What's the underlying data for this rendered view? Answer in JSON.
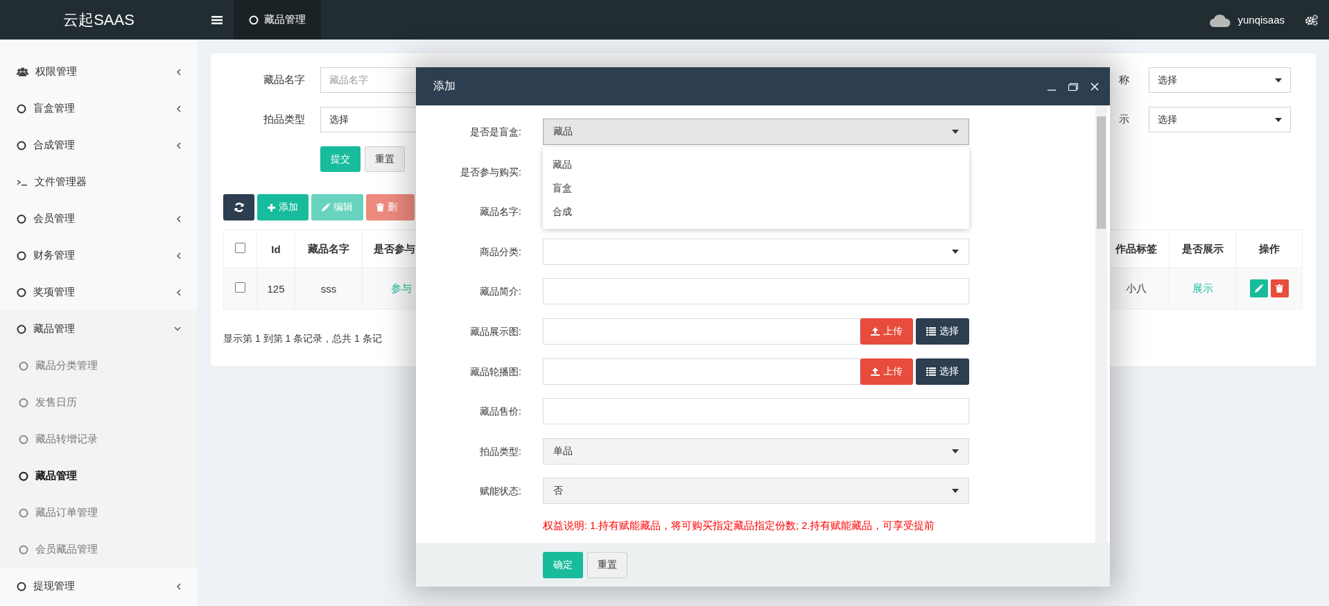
{
  "topbar": {
    "logo": "云起SAAS",
    "tab": {
      "label": "藏品管理",
      "selected": true
    },
    "user": "yunqisaas"
  },
  "sidebar": {
    "items": [
      {
        "label": "权限管理",
        "kind": "users",
        "expanded": false
      },
      {
        "label": "盲盒管理",
        "kind": "circle",
        "expanded": false
      },
      {
        "label": "合成管理",
        "kind": "circle",
        "expanded": false
      },
      {
        "label": "文件管理器",
        "kind": "terminal"
      },
      {
        "label": "会员管理",
        "kind": "circle",
        "expanded": false
      },
      {
        "label": "财务管理",
        "kind": "circle",
        "expanded": false
      },
      {
        "label": "奖项管理",
        "kind": "circle",
        "expanded": false
      },
      {
        "label": "藏品管理",
        "kind": "circle",
        "expanded": true,
        "children": [
          {
            "label": "藏品分类管理",
            "selected": false
          },
          {
            "label": "发售日历",
            "selected": false
          },
          {
            "label": "藏品转增记录",
            "selected": false
          },
          {
            "label": "藏品管理",
            "selected": true
          },
          {
            "label": "藏品订单管理",
            "selected": false
          },
          {
            "label": "会员藏品管理",
            "selected": false
          }
        ]
      },
      {
        "label": "提现管理",
        "kind": "circle",
        "expanded": false
      }
    ]
  },
  "filters": {
    "left": [
      {
        "label": "藏品名字",
        "kind": "input",
        "placeholder": "藏品名字"
      },
      {
        "label": "拍品类型",
        "kind": "select",
        "value": "选择"
      }
    ],
    "right": [
      {
        "label": "称",
        "kind": "select",
        "value": "选择"
      },
      {
        "label": "示",
        "kind": "select",
        "value": "选择"
      }
    ],
    "buttons": [
      {
        "label": "提交",
        "kind": "primary"
      },
      {
        "label": "重置",
        "kind": "default"
      }
    ]
  },
  "toolbar": [
    {
      "kind": "refresh",
      "disabled": false
    },
    {
      "kind": "add",
      "label": "添加",
      "disabled": false
    },
    {
      "kind": "edit",
      "label": "编辑",
      "disabled": true
    },
    {
      "kind": "delete",
      "label": "删",
      "disabled": true
    }
  ],
  "table": {
    "header_checked": false,
    "columns_left": [
      "Id",
      "藏品名字",
      "是否参与"
    ],
    "columns_right": [
      "作品标签",
      "是否展示",
      "操作"
    ],
    "rows": [
      {
        "checked": false,
        "id": "125",
        "name": "sss",
        "participate": "参与",
        "tag": "小八",
        "show": "展示"
      }
    ],
    "footer": "显示第 1 到第 1 条记录，总共 1 条记"
  },
  "modal": {
    "title": "添加",
    "fields": [
      {
        "label": "是否是盲盒:",
        "kind": "select",
        "value": "藏品",
        "focused": true,
        "options": [
          "藏品",
          "盲盒",
          "合成"
        ]
      },
      {
        "label": "是否参与购买:",
        "kind": "covered"
      },
      {
        "label": "藏品名字:",
        "kind": "covered"
      },
      {
        "label": "商品分类:",
        "kind": "select",
        "focused": false
      },
      {
        "label": "藏品简介:",
        "kind": "input"
      },
      {
        "label": "藏品展示图:",
        "kind": "upload",
        "buttons": [
          "上传",
          "选择"
        ]
      },
      {
        "label": "藏品轮播图:",
        "kind": "upload",
        "buttons": [
          "上传",
          "选择"
        ]
      },
      {
        "label": "藏品售价:",
        "kind": "input"
      },
      {
        "label": "拍品类型:",
        "kind": "select",
        "value": "单品",
        "focused": false
      },
      {
        "label": "赋能状态:",
        "kind": "select",
        "value": "否",
        "focused": false
      },
      {
        "kind": "note",
        "text": "权益说明: 1.持有赋能藏品，将可购买指定藏品指定份数; 2.持有赋能藏品，可享受提前"
      }
    ],
    "buttons": [
      {
        "label": "确定",
        "kind": "primary"
      },
      {
        "label": "重置",
        "kind": "default"
      }
    ]
  }
}
